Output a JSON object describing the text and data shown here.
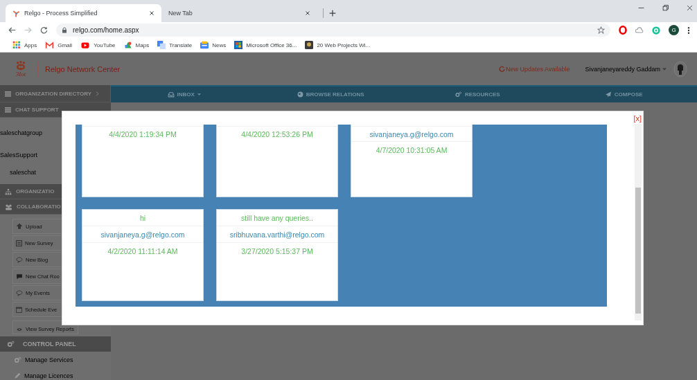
{
  "browser": {
    "tabs": [
      {
        "title": "Relgo - Process Simplified",
        "selected": true
      },
      {
        "title": "New Tab",
        "selected": false
      }
    ],
    "url": "relgo.com/home.aspx",
    "profile": "G",
    "bookmarks": [
      {
        "label": "Apps",
        "kind": "apps"
      },
      {
        "label": "Gmail",
        "kind": "mail"
      },
      {
        "label": "YouTube",
        "kind": "video"
      },
      {
        "label": "Maps",
        "kind": "map"
      },
      {
        "label": "Translate",
        "kind": "translate"
      },
      {
        "label": "News",
        "kind": "news"
      },
      {
        "label": "Microsoft Office 36...",
        "kind": "office"
      },
      {
        "label": "20 Web Projects Wi...",
        "kind": "thumb"
      }
    ]
  },
  "header": {
    "brand": "Relgo Network Center",
    "logo_caption": "3Iot",
    "updates": "New Updates Available",
    "user": "Sivanjaneyareddy Gaddam"
  },
  "nav": [
    {
      "label": "INBOX",
      "dropdown": true
    },
    {
      "label": "BROWSE RELATIONS",
      "dropdown": false
    },
    {
      "label": "RESOURCES",
      "dropdown": false
    },
    {
      "label": "COMPOSE",
      "dropdown": false
    }
  ],
  "sidebar": [
    {
      "kind": "header",
      "label": "ORGANIZATION DIRECTORY",
      "chevron": true
    },
    {
      "kind": "header",
      "label": "CHAT SUPPORT"
    },
    {
      "kind": "link",
      "label": "saleschatgroup"
    },
    {
      "kind": "link",
      "label": "SalesSupport"
    },
    {
      "kind": "sublink",
      "label": "saleschat"
    },
    {
      "kind": "header",
      "label": "ORGANIZATIO"
    },
    {
      "kind": "header",
      "label": "COLLABORATIO"
    },
    {
      "kind": "tool",
      "label": "Upload"
    },
    {
      "kind": "tool",
      "label": "New Survey"
    },
    {
      "kind": "tool",
      "label": "New Blog"
    },
    {
      "kind": "tool",
      "label": "New Chat Roo"
    },
    {
      "kind": "tool",
      "label": "My Events"
    },
    {
      "kind": "tool",
      "label": "Schedule Eve"
    },
    {
      "kind": "tool",
      "label": "View Survey Reports"
    },
    {
      "kind": "panel",
      "label": "CONTROL PANEL"
    },
    {
      "kind": "panel-link",
      "label": "Manage Services"
    },
    {
      "kind": "panel-link",
      "label": "Manage Licences"
    }
  ],
  "modal": {
    "close": "[x]",
    "cards": [
      {
        "lines": [
          {
            "kind": "date",
            "text": "4/4/2020 1:19:34 PM"
          }
        ]
      },
      {
        "lines": [
          {
            "kind": "date",
            "text": "4/4/2020 12:53:26 PM"
          }
        ]
      },
      {
        "lines": [
          {
            "kind": "email",
            "text": "sivanjaneya.g@relgo.com"
          },
          {
            "kind": "date",
            "text": "4/7/2020 10:31:05 AM"
          }
        ]
      },
      {
        "lines": [
          {
            "kind": "message",
            "text": "hi"
          },
          {
            "kind": "email",
            "text": "sivanjaneya.g@relgo.com"
          },
          {
            "kind": "date",
            "text": "4/2/2020 11:11:14 AM"
          }
        ]
      },
      {
        "lines": [
          {
            "kind": "message",
            "text": "still have any queries.."
          },
          {
            "kind": "email",
            "text": "sribhuvana.varthi@relgo.com"
          },
          {
            "kind": "date",
            "text": "3/27/2020 5:15:37 PM"
          }
        ]
      }
    ]
  }
}
